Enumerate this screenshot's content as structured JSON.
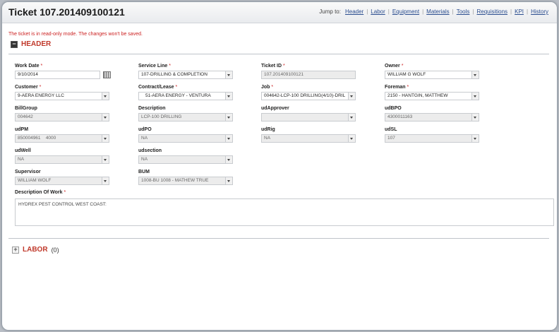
{
  "window": {
    "title": "Ticket 107.201409100121"
  },
  "jump": {
    "label": "Jump to:",
    "links": [
      "Header",
      "Labor",
      "Equipment",
      "Materials",
      "Tools",
      "Requisitions",
      "KPI",
      "History"
    ]
  },
  "notice": "The ticket is in read-only mode. The changes won't be saved.",
  "header_section": {
    "title": "HEADER"
  },
  "fields": {
    "work_date": {
      "label": "Work Date",
      "required": "*",
      "value": "9/10/2014"
    },
    "service_line": {
      "label": "Service Line",
      "required": "*",
      "value": "107-DRILLING & COMPLETION"
    },
    "ticket_id": {
      "label": "Ticket ID",
      "required": "*",
      "value": "107.201409100121"
    },
    "owner": {
      "label": "Owner",
      "required": "*",
      "value": "WILLIAM G WOLF"
    },
    "customer": {
      "label": "Customer",
      "required": "*",
      "value": "9-AERA ENERGY LLC"
    },
    "contract_lease": {
      "label": "Contract/Lease",
      "required": "*",
      "value": "51-AERA ENERGY - VENTURA"
    },
    "job": {
      "label": "Job",
      "required": "*",
      "value": "004642-LCP-100 DRILLING(4/10)-DRIL"
    },
    "foreman": {
      "label": "Foreman",
      "required": "*",
      "value": "2150 - HANTGIN, MATTHEW"
    },
    "billgroup": {
      "label": "BillGroup",
      "value": "004642"
    },
    "description": {
      "label": "Description",
      "value": "LCP-100 DRILLING"
    },
    "udapprover": {
      "label": "udApprover",
      "value": ""
    },
    "udbpo": {
      "label": "udBPO",
      "value": "4300011163"
    },
    "udpm": {
      "label": "udPM",
      "value": "850004961    4000"
    },
    "udpo": {
      "label": "udPO",
      "value": "NA"
    },
    "udrig": {
      "label": "udRig",
      "value": "NA"
    },
    "udsl": {
      "label": "udSL",
      "value": "107"
    },
    "udwell": {
      "label": "udWell",
      "value": "NA"
    },
    "udsection": {
      "label": "udsection",
      "value": "NA"
    },
    "supervisor": {
      "label": "Supervisor",
      "value": "WILLIAM WOLF"
    },
    "bum": {
      "label": "BUM",
      "value": "1008-BU 1008 - MATHEW TRUE"
    },
    "description_of_work": {
      "label": "Description Of Work",
      "required": "*",
      "value": "HYDREX PEST CONTROL WEST COAST:"
    }
  },
  "labor_section": {
    "title": "LABOR",
    "count": "(0)"
  }
}
